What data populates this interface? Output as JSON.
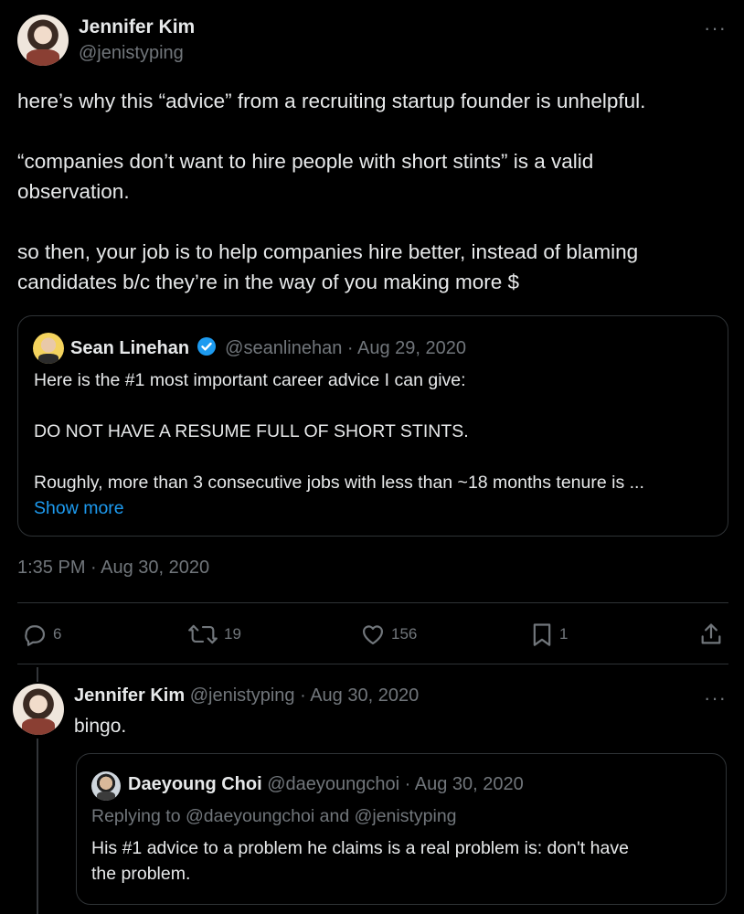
{
  "tweet": {
    "author_name": "Jennifer Kim",
    "author_handle": "@jenistyping",
    "text_line1": "here’s why this “advice” from a recruiting startup founder is unhelpful.",
    "text_line2": "“companies don’t want to hire people with short stints” is a valid",
    "text_line3": "observation.",
    "text_line4": "so then, your job is to help companies hire better, instead of blaming",
    "text_line5": "candidates b/c they’re in the way of you making more $",
    "timestamp": "1:35 PM · Aug 30, 2020",
    "more_label": "···"
  },
  "quote": {
    "author_name": "Sean Linehan",
    "author_handle": "@seanlinehan",
    "date": "· Aug 29, 2020",
    "line1": "Here is the #1 most important career advice I can give:",
    "line2": "DO NOT HAVE A RESUME FULL OF SHORT STINTS.",
    "line3": "Roughly, more than 3 consecutive jobs with less than ~18 months tenure is ...",
    "show_more": "Show more"
  },
  "actions": {
    "replies": "6",
    "retweets": "19",
    "likes": "156",
    "bookmarks": "1"
  },
  "reply": {
    "author_name": "Jennifer Kim",
    "author_handle": "@jenistyping",
    "date": "· Aug 30, 2020",
    "text": "bingo.",
    "more_label": "···"
  },
  "reply_quote": {
    "author_name": "Daeyoung Choi",
    "author_handle": "@daeyoungchoi",
    "date": "· Aug 30, 2020",
    "replying_to": "Replying to @daeyoungchoi and @jenistyping",
    "line1": "His #1 advice to a problem he claims is a real problem is: don't have",
    "line2": "the problem."
  },
  "colors": {
    "background": "#000000",
    "text": "#e7e9ea",
    "muted": "#71767b",
    "accent": "#1d9bf0",
    "border": "#2f3336"
  }
}
